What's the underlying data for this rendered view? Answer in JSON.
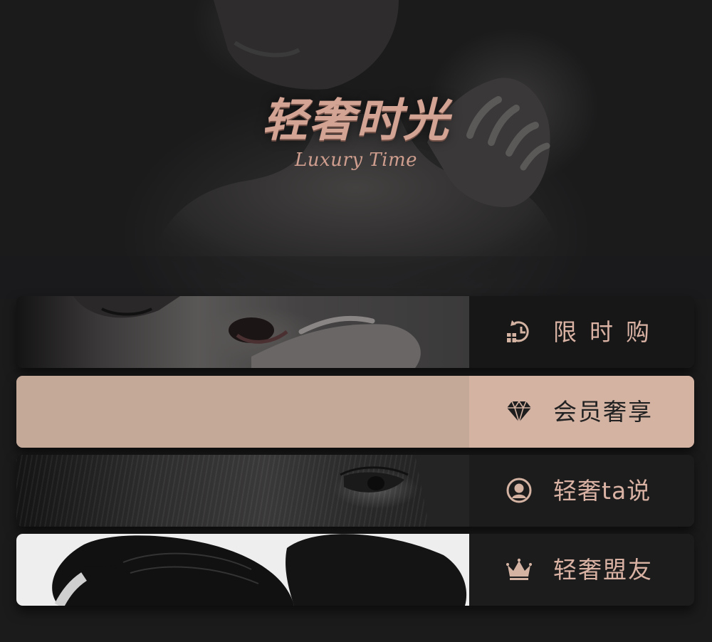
{
  "brand": {
    "title": "轻奢时光",
    "subtitle": "Luxury Time"
  },
  "menu": [
    {
      "label": "限时购",
      "icon": "clock-gift-icon"
    },
    {
      "label": "会员奢享",
      "icon": "diamond-icon"
    },
    {
      "label": "轻奢ta说",
      "icon": "user-avatar-icon"
    },
    {
      "label": "轻奢盟友",
      "icon": "crown-icon"
    }
  ],
  "colors": {
    "background": "#1b1b1c",
    "accent": "#d4b3a3",
    "label": "#d9b2a4"
  }
}
